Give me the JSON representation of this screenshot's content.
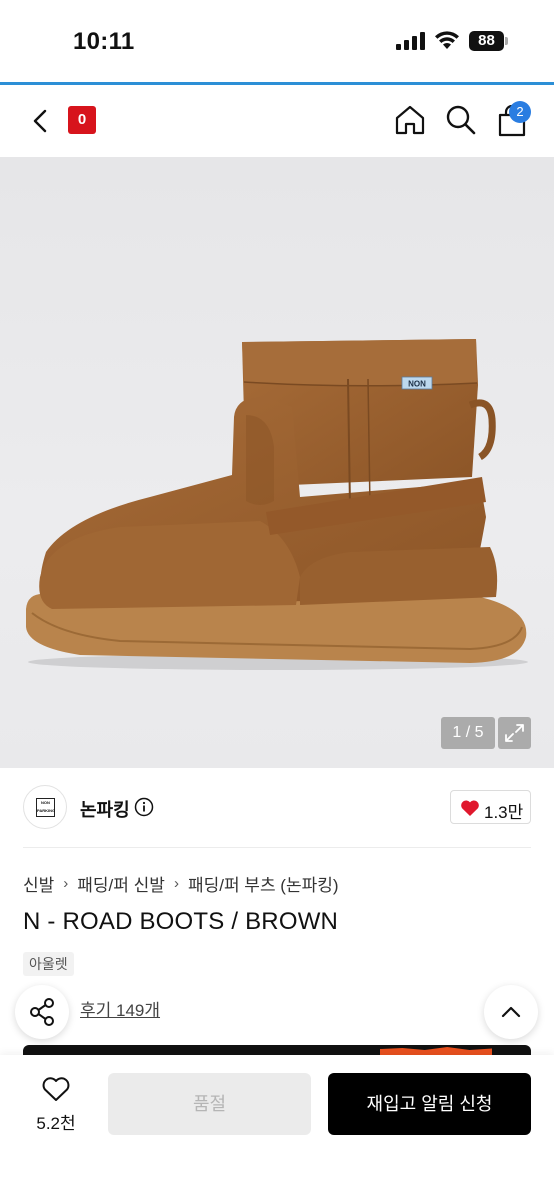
{
  "status_bar": {
    "time": "10:11",
    "battery": "88"
  },
  "nav": {
    "logo_letter": "0",
    "cart_count": "2"
  },
  "gallery": {
    "counter": "1 / 5",
    "boot_label": "NON",
    "colors": {
      "suede": "#9a6232",
      "suede_dark": "#7a4a22",
      "sole": "#b9844c"
    }
  },
  "brand": {
    "name": "논파킹",
    "logo_text_1": "NON",
    "logo_text_2": "PARKING",
    "likes": "1.3만"
  },
  "breadcrumb": {
    "items": [
      "신발",
      "패딩/퍼 신발",
      "패딩/퍼 부츠 (논파킹)"
    ]
  },
  "product": {
    "title": "N - ROAD BOOTS / BROWN",
    "tag": "아울렛",
    "rating_partial": "6",
    "reviews": "후기 149개"
  },
  "bottom_bar": {
    "wish_count": "5.2천",
    "soldout_label": "품절",
    "restock_label": "재입고 알림 신청"
  },
  "colors": {
    "accent_blue": "#2c8fd6",
    "logo_red": "#d7141c",
    "badge_blue": "#2a7de1",
    "heart_red": "#e0182d"
  }
}
